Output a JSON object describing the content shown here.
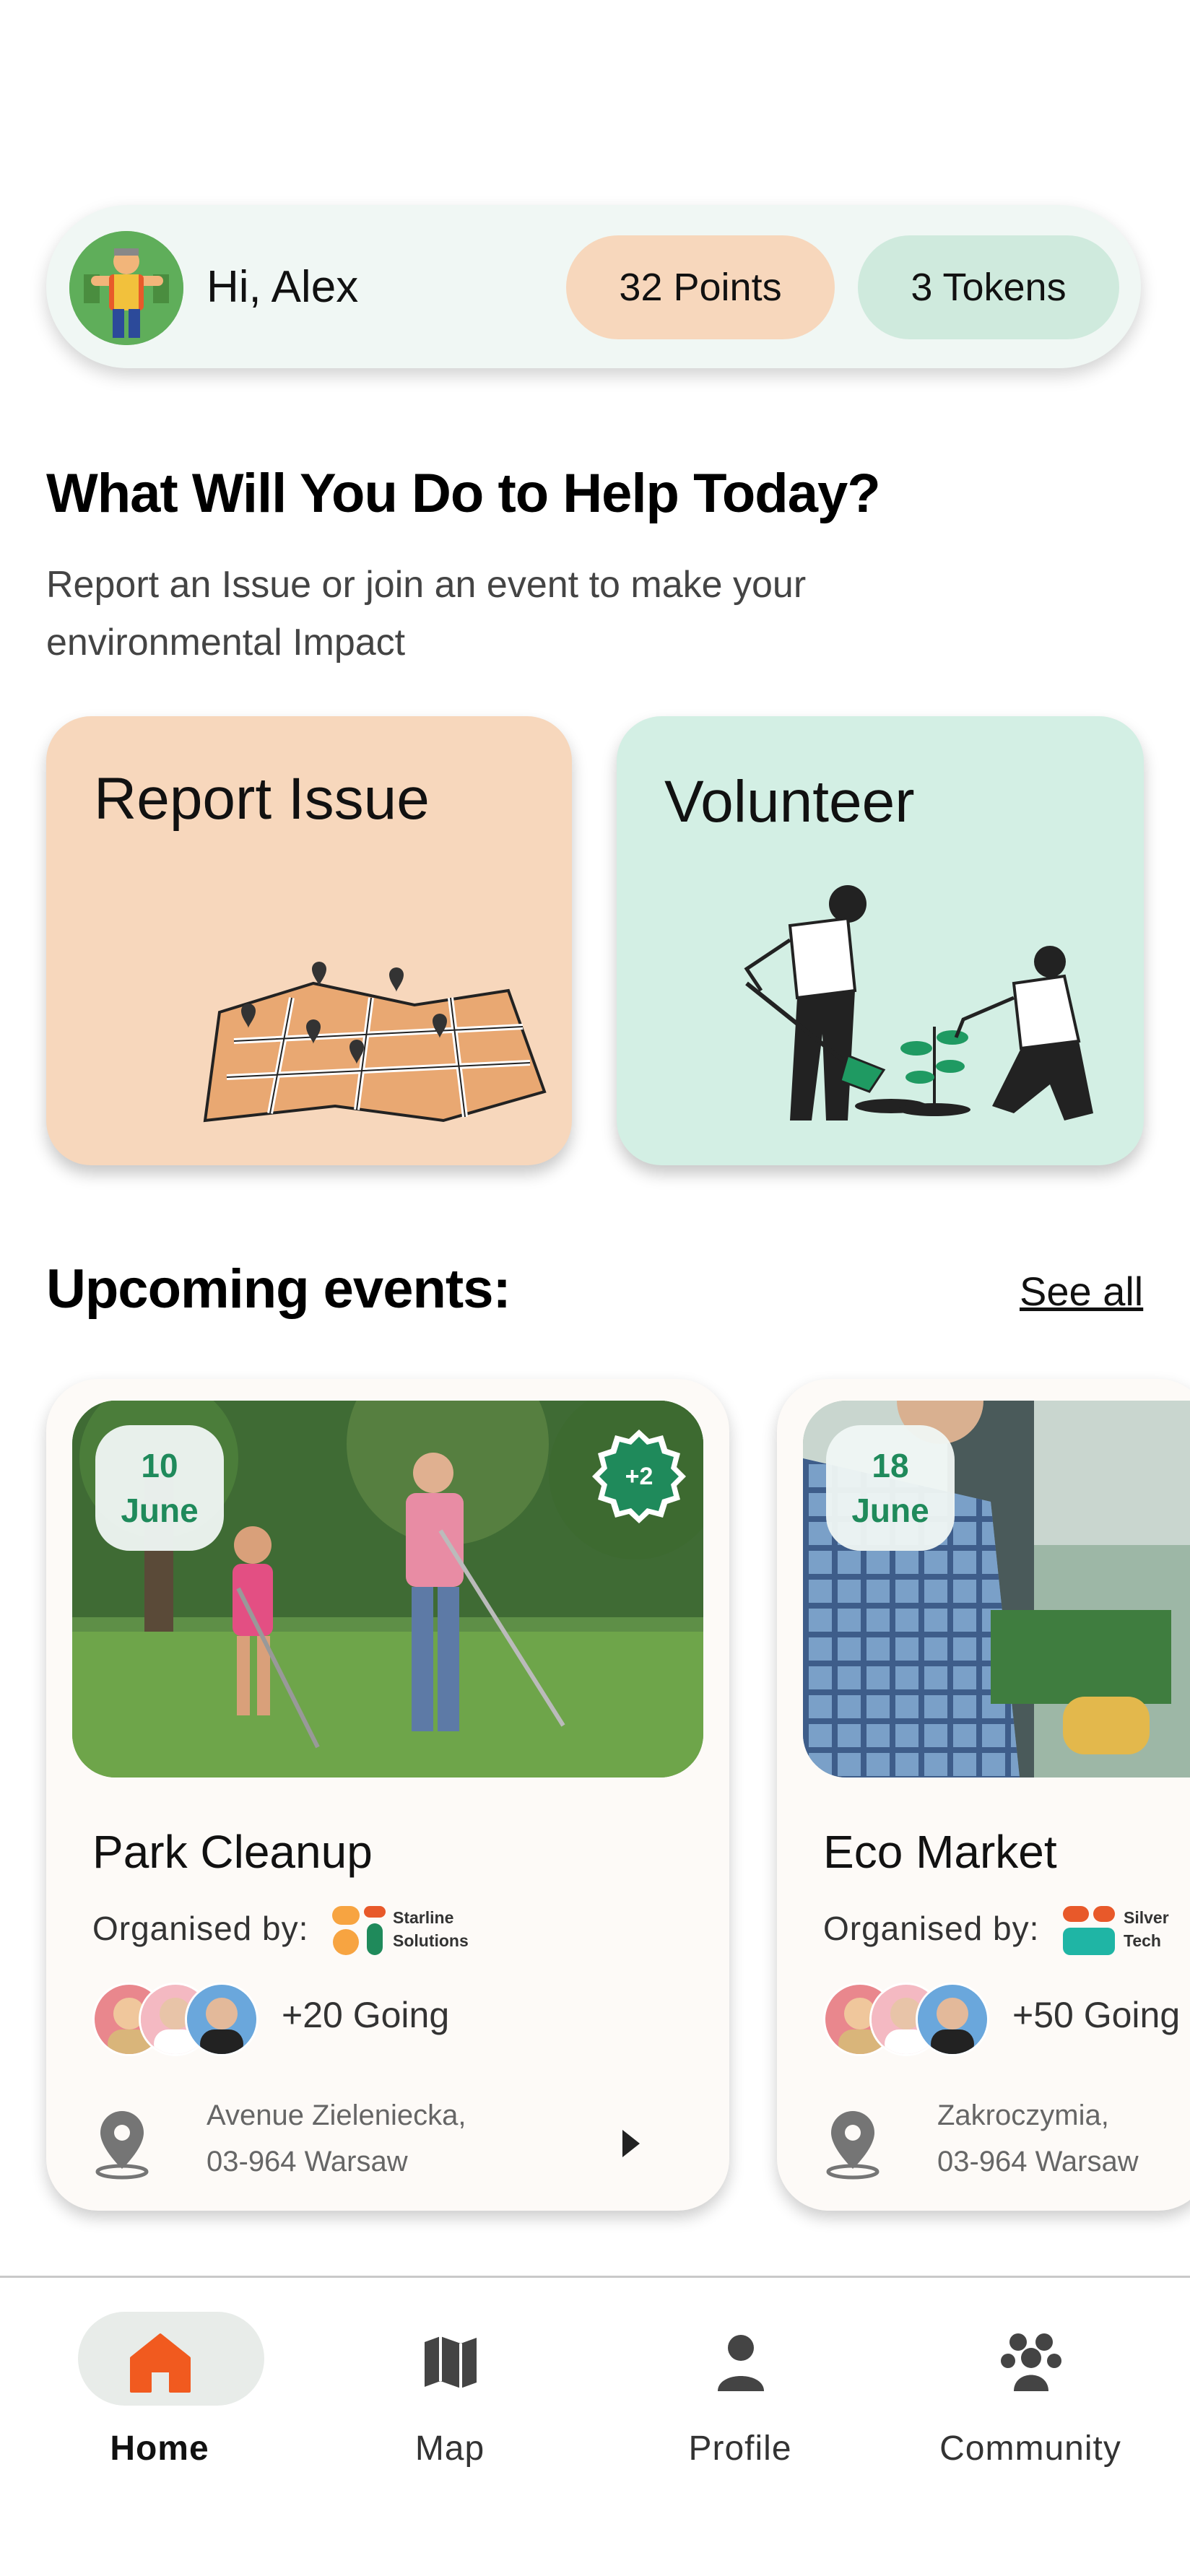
{
  "header": {
    "greeting": "Hi, Alex",
    "points": "32 Points",
    "tokens": "3 Tokens",
    "avatar_icon": "user-avatar"
  },
  "intro": {
    "title": "What Will You Do to Help Today?",
    "subtitle": "Report an Issue or join an event to make your environmental Impact"
  },
  "actions": {
    "report_label": "Report Issue",
    "volunteer_label": "Volunteer"
  },
  "events_section": {
    "title": "Upcoming events:",
    "see_all": "See all"
  },
  "events": [
    {
      "day": "10",
      "month": "June",
      "extra": "+2",
      "name": "Park Cleanup",
      "org_label": "Organised by:",
      "org_name_line1": "Starline",
      "org_name_line2": "Solutions",
      "going": "+20 Going",
      "address_line1": "Avenue Zieleniecka,",
      "address_line2": "03-964 Warsaw"
    },
    {
      "day": "18",
      "month": "June",
      "name": "Eco Market",
      "org_label": "Organised by:",
      "org_name_line1": "Silver",
      "org_name_line2": "Tech",
      "going": "+50 Going",
      "address_line1": "Zakroczymia,",
      "address_line2": "03-964 Warsaw"
    }
  ],
  "nav": {
    "items": [
      {
        "label": "Home",
        "icon": "home-icon",
        "active": true
      },
      {
        "label": "Map",
        "icon": "map-icon",
        "active": false
      },
      {
        "label": "Profile",
        "icon": "profile-icon",
        "active": false
      },
      {
        "label": "Community",
        "icon": "community-icon",
        "active": false
      }
    ]
  },
  "colors": {
    "accent_orange": "#f15a1f",
    "accent_green": "#1f8a5b",
    "peach": "#f7d7bc",
    "mint": "#d3efe4"
  }
}
